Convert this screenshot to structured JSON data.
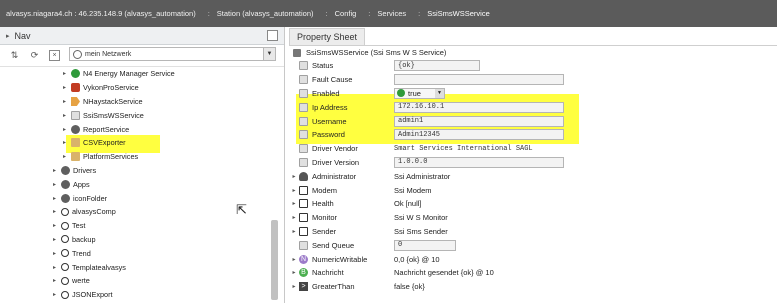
{
  "topbar": {
    "crumbs": [
      "alvasys.niagara4.ch : 46.235.148.9 (alvasys_automation)",
      "Station (alvasys_automation)",
      "Config",
      "Services",
      "SsiSmsWSService"
    ]
  },
  "nav": {
    "title": "Nav",
    "network_select": "mein Netzwerk",
    "tree": [
      {
        "label": "N4 Energy Manager Service",
        "icon": "green-dot-icon",
        "indent": 2,
        "expander": "▸"
      },
      {
        "label": "VykonProService",
        "icon": "red-square-icon",
        "indent": 2,
        "expander": "▸"
      },
      {
        "label": "NHaystackService",
        "icon": "tag-icon",
        "indent": 2,
        "expander": "▸"
      },
      {
        "label": "SsiSmsWSService",
        "icon": "slot-icon",
        "indent": 2,
        "expander": "▸",
        "selected": true
      },
      {
        "label": "ReportService",
        "icon": "gear-icon",
        "indent": 2,
        "expander": "▸"
      },
      {
        "label": "CSVExporter",
        "icon": "folder-icon",
        "indent": 2,
        "expander": "▸"
      },
      {
        "label": "PlatformServices",
        "icon": "platform-icon",
        "indent": 2,
        "expander": "▸"
      },
      {
        "label": "Drivers",
        "icon": "driver-icon",
        "indent": 1,
        "expander": "▸"
      },
      {
        "label": "Apps",
        "icon": "apps-icon",
        "indent": 1,
        "expander": "▸"
      },
      {
        "label": "iconFolder",
        "icon": "bell-icon",
        "indent": 1,
        "expander": "▸"
      },
      {
        "label": "alvasysComp",
        "icon": "circle-icon",
        "indent": 1,
        "expander": "▸"
      },
      {
        "label": "Test",
        "icon": "circle-icon",
        "indent": 1,
        "expander": "▸"
      },
      {
        "label": "backup",
        "icon": "circle-icon",
        "indent": 1,
        "expander": "▸"
      },
      {
        "label": "Trend",
        "icon": "circle-icon",
        "indent": 1,
        "expander": "▸"
      },
      {
        "label": "Templatealvasys",
        "icon": "circle-icon",
        "indent": 1,
        "expander": "▸"
      },
      {
        "label": "werte",
        "icon": "circle-icon",
        "indent": 1,
        "expander": "▸"
      },
      {
        "label": "JSONExport",
        "icon": "circle-icon",
        "indent": 1,
        "expander": "▸"
      }
    ]
  },
  "property_sheet": {
    "tab_label": "Property Sheet",
    "header": "SsiSmsWSService  (Ssi Sms W S Service)",
    "rows": [
      {
        "name": "Status",
        "value": "{ok}",
        "kind": "field-mid",
        "icon": "slot-icon",
        "expander": ""
      },
      {
        "name": "Fault Cause",
        "value": "",
        "kind": "field-wide",
        "icon": "slot-icon",
        "expander": ""
      },
      {
        "name": "Enabled",
        "value": "true",
        "kind": "enabled",
        "icon": "slot-icon",
        "expander": ""
      },
      {
        "name": "Ip Address",
        "value": "172.16.10.1",
        "kind": "field-wide",
        "icon": "slot-icon",
        "expander": ""
      },
      {
        "name": "Username",
        "value": "admin1",
        "kind": "field-wide",
        "icon": "slot-icon",
        "expander": ""
      },
      {
        "name": "Password",
        "value": "Admin12345",
        "kind": "field-wide",
        "icon": "slot-icon",
        "expander": ""
      },
      {
        "name": "Driver Vendor",
        "value": "Smart Services International SAGL",
        "kind": "mono",
        "icon": "slot-icon",
        "expander": ""
      },
      {
        "name": "Driver Version",
        "value": "1.0.0.0",
        "kind": "field-wide",
        "icon": "slot-icon",
        "expander": ""
      },
      {
        "name": "Administrator",
        "value": "Ssi Administrator",
        "kind": "plain",
        "icon": "person-icon",
        "expander": "▸"
      },
      {
        "name": "Modem",
        "value": "Ssi Modem",
        "kind": "plain",
        "icon": "monitor-icon",
        "expander": "▸"
      },
      {
        "name": "Health",
        "value": "Ok [null]",
        "kind": "plain",
        "icon": "monitor-icon",
        "expander": "▸"
      },
      {
        "name": "Monitor",
        "value": "Ssi W S Monitor",
        "kind": "plain",
        "icon": "monitor-icon",
        "expander": "▸"
      },
      {
        "name": "Sender",
        "value": "Ssi Sms Sender",
        "kind": "plain",
        "icon": "send-icon",
        "expander": "▸"
      },
      {
        "name": "Send Queue",
        "value": "0",
        "kind": "field-small",
        "icon": "slot-icon",
        "expander": ""
      },
      {
        "name": "NumericWritable",
        "value": "0,0 {ok} @ 10",
        "kind": "plain",
        "icon": "numeric-icon",
        "expander": "▸"
      },
      {
        "name": "Nachricht",
        "value": "Nachricht gesendet {ok} @ 10",
        "kind": "plain",
        "icon": "boolean-icon",
        "expander": "▸"
      },
      {
        "name": "GreaterThan",
        "value": "false {ok}",
        "kind": "plain",
        "icon": "greater-than-icon",
        "expander": "▸"
      }
    ]
  }
}
